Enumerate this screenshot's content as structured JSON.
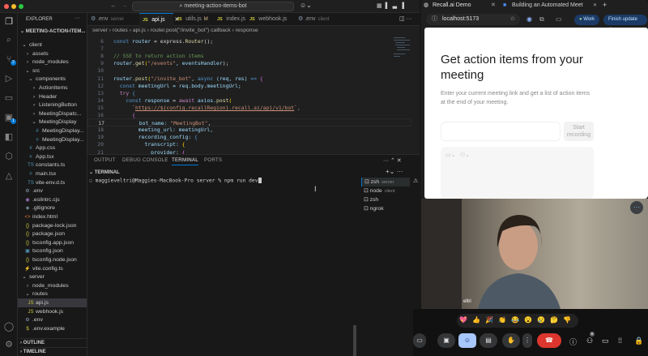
{
  "window": {
    "command_center": "meeting-action-items-bot"
  },
  "activity_bar": {
    "source_control_badge": "2",
    "extensions_badge": "1"
  },
  "explorer": {
    "title": "EXPLORER",
    "root": "MEETING-ACTION-ITEM...",
    "items": [
      {
        "label": "client",
        "depth": 1,
        "kind": "open"
      },
      {
        "label": "assets",
        "depth": 2,
        "kind": "closed"
      },
      {
        "label": "node_modules",
        "depth": 2,
        "kind": "closed"
      },
      {
        "label": "src",
        "depth": 2,
        "kind": "open"
      },
      {
        "label": "components",
        "depth": 3,
        "kind": "open"
      },
      {
        "label": "ActionItems",
        "depth": 4,
        "kind": "closed"
      },
      {
        "label": "Header",
        "depth": 4,
        "kind": "closed"
      },
      {
        "label": "ListeningButton",
        "depth": 4,
        "kind": "closed"
      },
      {
        "label": "MeetingDispatc...",
        "depth": 4,
        "kind": "closed"
      },
      {
        "label": "MeetingDisplay",
        "depth": 4,
        "kind": "open"
      },
      {
        "label": "MeetingDisplay...",
        "depth": 5,
        "kind": "file",
        "icon": "#",
        "color": "#519aba"
      },
      {
        "label": "MeetingDisplay...",
        "depth": 5,
        "kind": "file",
        "icon": "⚛",
        "color": "#519aba"
      },
      {
        "label": "App.css",
        "depth": 3,
        "kind": "file",
        "icon": "#",
        "color": "#519aba"
      },
      {
        "label": "App.tsx",
        "depth": 3,
        "kind": "file",
        "icon": "⚛",
        "color": "#519aba"
      },
      {
        "label": "constants.ts",
        "depth": 3,
        "kind": "file",
        "icon": "TS",
        "color": "#519aba"
      },
      {
        "label": "main.tsx",
        "depth": 3,
        "kind": "file",
        "icon": "⚛",
        "color": "#519aba"
      },
      {
        "label": "vite-env.d.ts",
        "depth": 3,
        "kind": "file",
        "icon": "TS",
        "color": "#519aba"
      },
      {
        "label": ".env",
        "depth": 2,
        "kind": "file",
        "icon": "⚙",
        "color": "#8b9fb1"
      },
      {
        "label": ".eslintrc.cjs",
        "depth": 2,
        "kind": "file",
        "icon": "◉",
        "color": "#a074c4"
      },
      {
        "label": ".gitignore",
        "depth": 2,
        "kind": "file",
        "icon": "◆",
        "color": "#6d8086"
      },
      {
        "label": "index.html",
        "depth": 2,
        "kind": "file",
        "icon": "<>",
        "color": "#e37933"
      },
      {
        "label": "package-lock.json",
        "depth": 2,
        "kind": "file",
        "icon": "{}",
        "color": "#cbcb41"
      },
      {
        "label": "package.json",
        "depth": 2,
        "kind": "file",
        "icon": "{}",
        "color": "#cbcb41"
      },
      {
        "label": "tsconfig.app.json",
        "depth": 2,
        "kind": "file",
        "icon": "{}",
        "color": "#cbcb41"
      },
      {
        "label": "tsconfig.json",
        "depth": 2,
        "kind": "file",
        "icon": "▣",
        "color": "#519aba"
      },
      {
        "label": "tsconfig.node.json",
        "depth": 2,
        "kind": "file",
        "icon": "{}",
        "color": "#cbcb41"
      },
      {
        "label": "vite.config.ts",
        "depth": 2,
        "kind": "file",
        "icon": "⚡",
        "color": "#ffcc00"
      },
      {
        "label": "server",
        "depth": 1,
        "kind": "open"
      },
      {
        "label": "node_modules",
        "depth": 2,
        "kind": "closed"
      },
      {
        "label": "routes",
        "depth": 2,
        "kind": "open"
      },
      {
        "label": "api.js",
        "depth": 3,
        "kind": "file",
        "icon": "JS",
        "color": "#cbcb41",
        "selected": true
      },
      {
        "label": "webhook.js",
        "depth": 3,
        "kind": "file",
        "icon": "JS",
        "color": "#cbcb41"
      },
      {
        "label": ".env",
        "depth": 2,
        "kind": "file",
        "icon": "⚙",
        "color": "#8b9fb1"
      },
      {
        "label": ".env.example",
        "depth": 2,
        "kind": "file",
        "icon": "$",
        "color": "#cbcb41"
      }
    ],
    "outline": "OUTLINE",
    "timeline": "TIMELINE"
  },
  "tabs": [
    {
      "label": ".env",
      "sub": "server",
      "icon": "⚙"
    },
    {
      "label": "api.js",
      "icon": "JS",
      "active": true
    },
    {
      "label": "utils.js",
      "sub": "M",
      "icon": "JS"
    },
    {
      "label": "index.js",
      "icon": "JS"
    },
    {
      "label": "webhook.js",
      "icon": "JS"
    },
    {
      "label": ".env",
      "sub": "client",
      "icon": "⚙"
    }
  ],
  "breadcrumb": [
    "server",
    "routes",
    "api.js",
    "router.post(\"/invite_bot\") callback",
    "response"
  ],
  "code": [
    {
      "n": "6",
      "seg": [
        [
          "const ",
          "kw"
        ],
        [
          "router",
          "var"
        ],
        [
          " = express.",
          "pl"
        ],
        [
          "Router",
          "fn"
        ],
        [
          "();",
          "pl"
        ]
      ]
    },
    {
      "n": "7",
      "seg": []
    },
    {
      "n": "8",
      "seg": [
        [
          "// SSE to return action items",
          "cm"
        ]
      ]
    },
    {
      "n": "9",
      "seg": [
        [
          "router",
          "var"
        ],
        [
          ".",
          "pl"
        ],
        [
          "get",
          "fn"
        ],
        [
          "(",
          "br"
        ],
        [
          "\"/events\"",
          "str"
        ],
        [
          ", eventsHandler",
          "var"
        ],
        [
          ");",
          "pl"
        ]
      ]
    },
    {
      "n": "10",
      "seg": []
    },
    {
      "n": "11",
      "seg": [
        [
          "router",
          "var"
        ],
        [
          ".",
          "pl"
        ],
        [
          "post",
          "fn"
        ],
        [
          "(",
          "br"
        ],
        [
          "\"/invite_bot\"",
          "str"
        ],
        [
          ", ",
          "pl"
        ],
        [
          "async ",
          "kw"
        ],
        [
          "(req, res) ",
          "var"
        ],
        [
          "=> ",
          "kw"
        ],
        [
          "{",
          "br2"
        ]
      ]
    },
    {
      "n": "12",
      "seg": [
        [
          "  const ",
          "kw"
        ],
        [
          "meetingUrl",
          "var"
        ],
        [
          " = req.body.meetingUrl;",
          "var"
        ]
      ]
    },
    {
      "n": "13",
      "seg": [
        [
          "  try ",
          "ctl"
        ],
        [
          "{",
          "kw"
        ]
      ]
    },
    {
      "n": "14",
      "seg": [
        [
          "    const ",
          "kw"
        ],
        [
          "response",
          "var"
        ],
        [
          " = ",
          "pl"
        ],
        [
          "await ",
          "ctl"
        ],
        [
          "axios.",
          "var"
        ],
        [
          "post",
          "fn"
        ],
        [
          "(",
          "br"
        ]
      ]
    },
    {
      "n": "15",
      "seg": [
        [
          "      `",
          "str"
        ],
        [
          "https://${config.recallRegion}.recall.ai/api/v1/bot",
          "url"
        ],
        [
          "`,",
          "str"
        ]
      ]
    },
    {
      "n": "16",
      "seg": [
        [
          "      {",
          "br2"
        ]
      ]
    },
    {
      "n": "17",
      "seg": [
        [
          "        bot_name: ",
          "var"
        ],
        [
          "\"MeetingBot\"",
          "str"
        ],
        [
          ",",
          "pl"
        ]
      ],
      "current": true
    },
    {
      "n": "18",
      "seg": [
        [
          "        meeting_url: meetingUrl,",
          "var"
        ]
      ]
    },
    {
      "n": "19",
      "seg": [
        [
          "        recording_config: ",
          "var"
        ],
        [
          "{",
          "kw"
        ]
      ]
    },
    {
      "n": "20",
      "seg": [
        [
          "          transcript: ",
          "var"
        ],
        [
          "{",
          "br"
        ]
      ]
    },
    {
      "n": "21",
      "seg": [
        [
          "            provider: ",
          "var"
        ],
        [
          "{",
          "br2"
        ]
      ]
    }
  ],
  "panel": {
    "tabs": [
      "OUTPUT",
      "DEBUG CONSOLE",
      "TERMINAL",
      "PORTS"
    ],
    "active_tab": "TERMINAL",
    "section": "TERMINAL",
    "prompt": "maggieveltri@Maggies-MacBook-Pro server % npm run dev",
    "terminals": [
      {
        "label": "zsh",
        "sub": "server"
      },
      {
        "label": "node",
        "sub": "client"
      },
      {
        "label": "zsh",
        "sub": ""
      },
      {
        "label": "ngrok",
        "sub": ""
      }
    ]
  },
  "browser": {
    "tabs": [
      "Recall.ai Demo",
      "Building an Automated Meet"
    ],
    "url": "localhost:5173",
    "profile": "Work",
    "update": "Finish update",
    "page": {
      "heading": "Get action items from your meeting",
      "description": "Enter your current meeting link and get a list of action items at the end of your meeting.",
      "button": "Start recording"
    }
  },
  "meet": {
    "reactions": [
      "💖",
      "👍",
      "🎉",
      "👏",
      "😂",
      "😮",
      "😢",
      "🤔",
      "👎"
    ],
    "participants_badge": "5",
    "name_tag": "eltri"
  }
}
